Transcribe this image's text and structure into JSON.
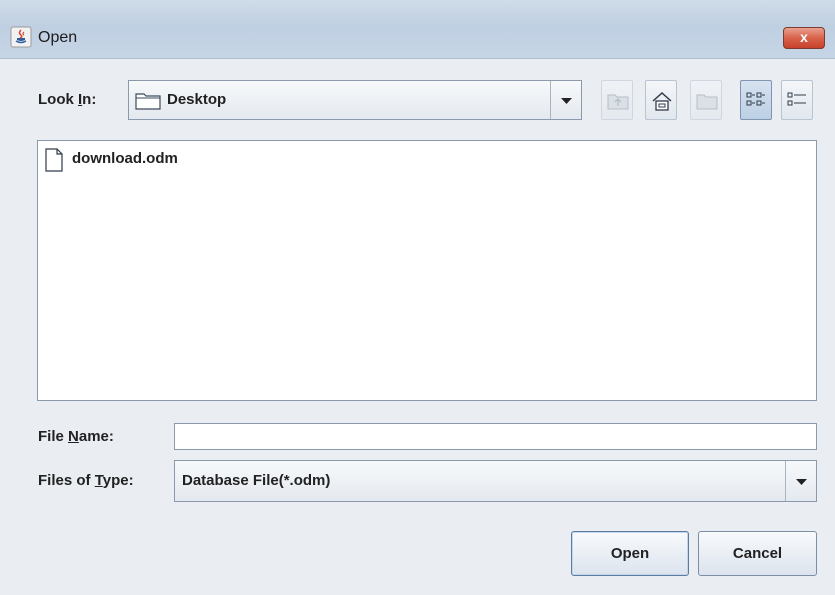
{
  "window": {
    "title": "Open",
    "close_label": "x",
    "colors": {
      "titlebar": "#c6d5e6",
      "close_button": "#d9624b",
      "body": "#eaeef3"
    }
  },
  "look_in": {
    "label_pre": "Look ",
    "label_mnemonic": "I",
    "label_post": "n:",
    "value": "Desktop"
  },
  "toolbar": {
    "buttons": [
      {
        "name": "up-one-level",
        "icon": "folder-up-icon",
        "enabled": false
      },
      {
        "name": "home",
        "icon": "home-icon",
        "enabled": true
      },
      {
        "name": "new-folder",
        "icon": "new-folder-icon",
        "enabled": false
      },
      {
        "name": "list-view",
        "icon": "list-view-icon",
        "selected": true
      },
      {
        "name": "details-view",
        "icon": "details-view-icon",
        "selected": false
      }
    ]
  },
  "file_list": {
    "items": [
      {
        "name": "download.odm",
        "icon": "document-icon"
      }
    ]
  },
  "file_name": {
    "label_pre": "File ",
    "label_mnemonic": "N",
    "label_post": "ame:",
    "value": "",
    "placeholder": ""
  },
  "files_of_type": {
    "label_pre": "Files of ",
    "label_mnemonic": "T",
    "label_post": "ype:",
    "value": "Database File(*.odm)"
  },
  "buttons": {
    "open": "Open",
    "cancel": "Cancel"
  }
}
